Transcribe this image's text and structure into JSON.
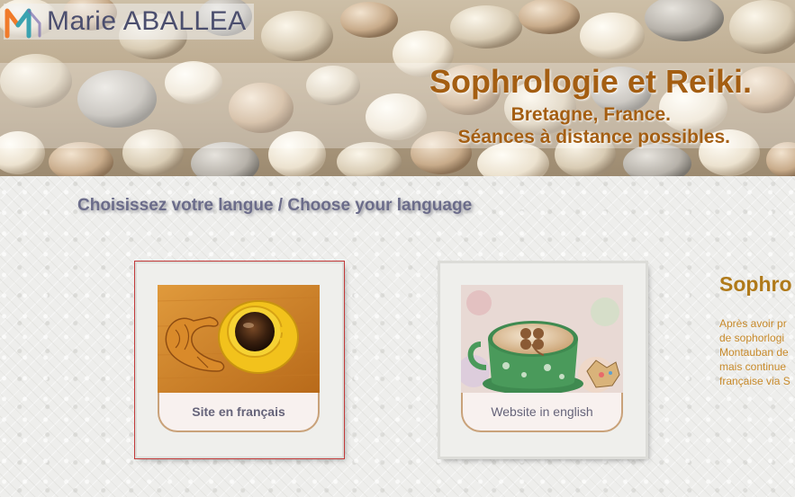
{
  "header": {
    "logo_text": "Marie ABALLEA",
    "title": "Sophrologie et Reiki.",
    "subtitle_1": "Bretagne, France.",
    "subtitle_2": "Séances à distance possibles."
  },
  "main": {
    "heading": "Choisissez votre langue / Choose your language",
    "cards": [
      {
        "label": "Site en français",
        "image": "croissant-and-coffee"
      },
      {
        "label": "Website in english",
        "image": "cappuccino-cup"
      }
    ]
  },
  "side": {
    "title": "Sophro",
    "lines": [
      "Après avoir pr",
      "de sophorlogi",
      "Montauban de",
      "mais continue",
      "française via S"
    ]
  },
  "colors": {
    "title": "#a45e12",
    "heading": "#6b6c8a",
    "side_text": "#c88a2a",
    "logo_orange": "#f07b2a",
    "logo_teal": "#3aa2b0"
  }
}
